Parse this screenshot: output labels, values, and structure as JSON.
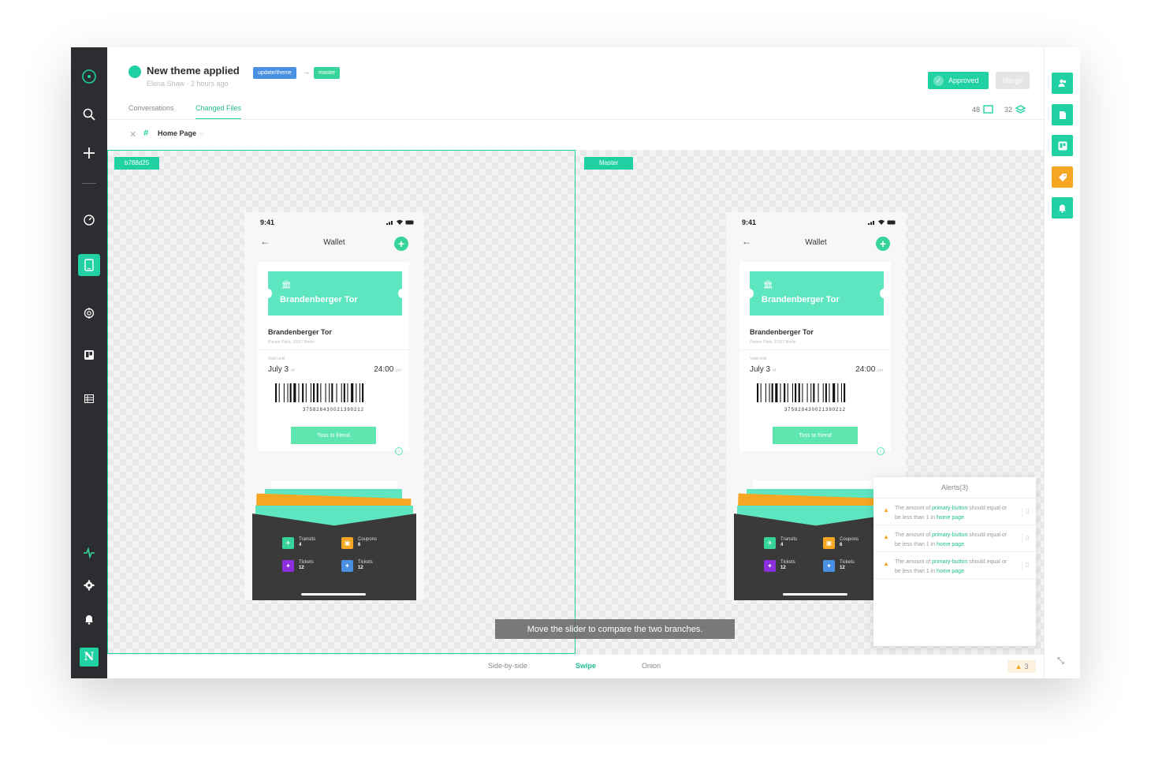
{
  "header": {
    "title": "New theme applied",
    "subtitle": "Elena Shaw · 2 hours ago",
    "branch_source": "update/theme",
    "branch_arrow": "→",
    "branch_target": "master",
    "approved_label": "Approved",
    "merge_label": "Merge",
    "tabs": [
      {
        "label": "Conversations",
        "active": false
      },
      {
        "label": "Changed Files",
        "active": true
      }
    ],
    "artboards_count": "48",
    "layers_count": "32",
    "breadcrumb": "Home Page"
  },
  "canvas": {
    "left_tag": "b788d25",
    "right_tag": "Master",
    "hint": "Move the slider to compare the two branches."
  },
  "phone": {
    "time": "9:41",
    "nav_title": "Wallet",
    "ticket_name": "Brandenberger Tor",
    "place": "Brandenberger Tor",
    "address": "Pariser Platz, 10117 Berlin",
    "valid_label": "Valid until",
    "date": "July 3",
    "date_suffix": "rd",
    "time_value": "24:00",
    "time_suffix": "pm",
    "barcode_number": "375828430021390212",
    "toss_label": "Toss to friend",
    "wallet_items": [
      {
        "label": "Transits",
        "count": "4",
        "color": "#36d39b",
        "icon": "plane-icon"
      },
      {
        "label": "Coupons",
        "count": "6",
        "color": "#f5a623",
        "icon": "coupon-icon"
      },
      {
        "label": "Tickets",
        "count": "12",
        "color": "#8b2fdc",
        "icon": "ticket-icon"
      },
      {
        "label": "Tickets",
        "count": "12",
        "color": "#4a90e2",
        "icon": "ticket-icon"
      }
    ]
  },
  "alerts": {
    "title": "Alerts(3)",
    "items": [
      {
        "pre": "The amount of ",
        "hl1": "primary-button",
        "mid": " should equal or be less than 1 in ",
        "hl2": "home page",
        "post": "."
      },
      {
        "pre": "The amount of ",
        "hl1": "primary-button",
        "mid": " should equal or be less than 1 in ",
        "hl2": "home page",
        "post": "."
      },
      {
        "pre": "The amount of ",
        "hl1": "primary-button",
        "mid": " should equal or be less than 1 in ",
        "hl2": "home page",
        "post": "."
      }
    ]
  },
  "footer": {
    "modes": [
      {
        "label": "Side-by-side",
        "active": false
      },
      {
        "label": "Swipe",
        "active": true
      },
      {
        "label": "Onion",
        "active": false
      }
    ],
    "warning_count": "3"
  },
  "sidebar": {
    "logo_letter": "N",
    "icons": [
      "home-icon",
      "search-icon",
      "add-icon",
      "dashboard-icon",
      "device-icon",
      "openai-icon",
      "board-icon",
      "table-icon",
      "activity-icon",
      "settings-icon",
      "bell-icon"
    ]
  },
  "rightbar": {
    "icons": [
      "users-icon",
      "document-icon",
      "board-icon",
      "tag-icon",
      "bell-icon",
      "collapse-icon"
    ]
  },
  "colors": {
    "accent": "#1fd1a3",
    "sidebar": "#2b2d30",
    "warning": "#f5a623",
    "branch_source": "#4a90e2"
  }
}
